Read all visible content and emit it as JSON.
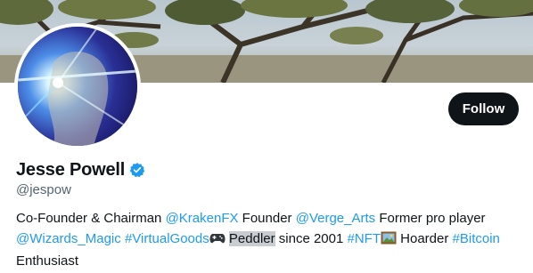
{
  "profile": {
    "display_name": "Jesse Powell",
    "handle": "@jespow",
    "follow_label": "Follow"
  },
  "bio": {
    "t1": "Co-Founder & Chairman ",
    "link1": "@KrakenFX",
    "t2": " Founder ",
    "link2": "@Verge_Arts",
    "t3": " Former pro player",
    "link3": "@Wizards_Magic",
    "t4": " ",
    "link4": "#VirtualGoods",
    "t5": " ",
    "highlight": "Peddler",
    "t6": " since 2001 ",
    "link5": "#NFT",
    "t7": " Hoarder ",
    "link6": "#Bitcoin",
    "t8": "Enthusiast"
  },
  "icons": {
    "verified": "verified-badge-icon",
    "controller": "game-controller-emoji",
    "frame": "framed-picture-emoji"
  },
  "colors": {
    "link": "#1d9bf0",
    "verified": "#1d9bf0",
    "button_bg": "#0f1419",
    "handle": "#536471"
  }
}
